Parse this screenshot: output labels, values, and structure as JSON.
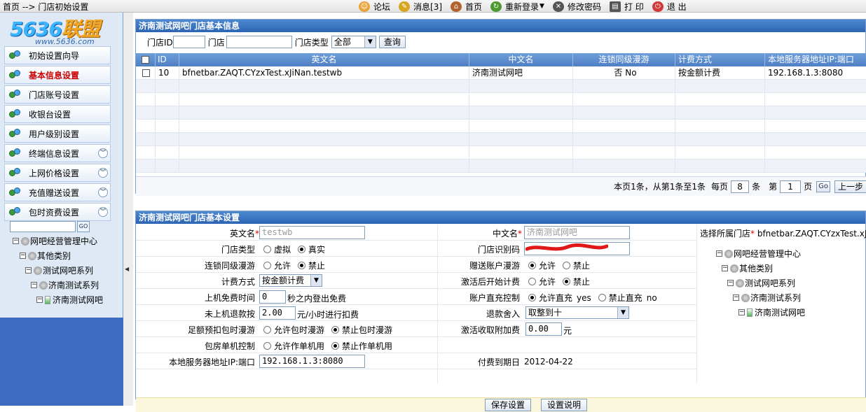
{
  "topbar": {
    "breadcrumb": "首页 --> 门店初始设置",
    "nav": [
      {
        "label": "论坛",
        "icon": "forum-icon",
        "color": "#e9a53a"
      },
      {
        "label": "消息[3]",
        "icon": "message-icon",
        "color": "#d8a520"
      },
      {
        "label": "首页",
        "icon": "home-icon",
        "color": "#b2622d"
      },
      {
        "label": "重新登录",
        "icon": "relogin-icon",
        "color": "#4c9a2f"
      },
      {
        "label": "修改密码",
        "icon": "password-icon",
        "color": "#555555"
      },
      {
        "label": "打 印",
        "icon": "printer-icon",
        "color": "#555555"
      },
      {
        "label": "退 出",
        "icon": "exit-icon",
        "color": "#d03a3a"
      }
    ]
  },
  "logo": {
    "brand_num": "5636",
    "brand_cn": "联盟",
    "url": "www.5636.com"
  },
  "sidebar": {
    "items": [
      {
        "label": "初始设置向导",
        "expand": false,
        "active": false
      },
      {
        "label": "基本信息设置",
        "expand": false,
        "active": true
      },
      {
        "label": "门店账号设置",
        "expand": false,
        "active": false
      },
      {
        "label": "收银台设置",
        "expand": false,
        "active": false
      },
      {
        "label": "用户级别设置",
        "expand": false,
        "active": false
      },
      {
        "label": "终端信息设置",
        "expand": true,
        "active": false
      },
      {
        "label": "上网价格设置",
        "expand": true,
        "active": false
      },
      {
        "label": "充值赠送设置",
        "expand": true,
        "active": false
      },
      {
        "label": "包时资费设置",
        "expand": true,
        "active": false
      }
    ],
    "go_label": "GO",
    "tree": [
      "网吧经营管理中心",
      "其他类别",
      "测试网吧系列",
      "济南测试系列",
      "济南测试网吧"
    ]
  },
  "info_panel": {
    "title": "济南测试网吧门店基本信息",
    "query": {
      "store_id_label": "门店ID",
      "store_id_value": "",
      "store_label": "门店",
      "store_value": "",
      "type_label": "门店类型",
      "type_value": "全部",
      "query_button": "查询"
    },
    "columns": [
      "ID",
      "英文名",
      "中文名",
      "连锁同级漫游",
      "计费方式",
      "本地服务器地址IP:端口"
    ],
    "rows": [
      {
        "id": "10",
        "en": "bfnetbar.ZAQT.CYzxTest.xJiNan.testwb",
        "cn": "济南测试网吧",
        "roam": "否  No",
        "billing": "按金额计费",
        "ip": "192.168.1.3:8080"
      }
    ],
    "pager": {
      "summary": "本页1条，从第1条至1条",
      "per_page_label": "每页",
      "per_page": "8",
      "unit": "条",
      "page_label": "第",
      "page": "1",
      "page_unit": "页",
      "go": "Go",
      "prev": "上一步"
    }
  },
  "settings_panel": {
    "title": "济南测试网吧门店基本设置",
    "en_name_label": "英文名",
    "en_name": "testwb",
    "cn_name_label": "中文名",
    "cn_name": "济南测试网吧",
    "select_store_label": "选择所属门店",
    "select_store_value": "bfnetbar.ZAQT.CYzxTest.xJiN",
    "store_type_label": "门店类型",
    "store_type_options": [
      "虚拟",
      "真实"
    ],
    "store_type_selected": 1,
    "store_code_label": "门店识别码",
    "store_code": "",
    "roam_label": "连锁同级漫游",
    "roam_options": [
      "允许",
      "禁止"
    ],
    "roam_selected": 1,
    "gift_roam_label": "赠送账户漫游",
    "gift_roam_options": [
      "允许",
      "禁止"
    ],
    "gift_roam_selected": 0,
    "billing_label": "计费方式",
    "billing_value": "按金额计费",
    "activate_billing_label": "激活后开始计费",
    "activate_billing_options": [
      "允许",
      "禁止"
    ],
    "activate_billing_selected": 1,
    "free_time_label": "上机免费时间",
    "free_time": "0",
    "free_time_suffix": "秒之内登出免费",
    "topup_label": "账户直充控制",
    "topup_options": [
      "允许直充",
      "禁止直充"
    ],
    "topup_extra": [
      "yes",
      "no"
    ],
    "topup_selected": 0,
    "refund_label": "未上机退款按",
    "refund_value": "2.00",
    "refund_suffix": "元/小时进行扣费",
    "rounding_label": "退款舍入",
    "rounding_value": "取整到十",
    "prepay_label": "足额预扣包时漫游",
    "prepay_options": [
      "允许包时漫游",
      "禁止包时漫游"
    ],
    "prepay_selected": 1,
    "activate_fee_label": "激活收取附加费",
    "activate_fee": "0.00",
    "activate_fee_suffix": "元",
    "room_label": "包房单机控制",
    "room_options": [
      "允许作单机用",
      "禁止作单机用"
    ],
    "room_selected": 1,
    "server_label": "本地服务器地址IP:端口",
    "server_value": "192.168.1.3:8080",
    "expiry_label": "付费到期日",
    "expiry_value": "2012-04-22",
    "save_button": "保存设置",
    "help_button": "设置说明",
    "tree": [
      "网吧经营管理中心",
      "其他类别",
      "测试网吧系列",
      "济南测试系列",
      "济南测试网吧"
    ]
  }
}
